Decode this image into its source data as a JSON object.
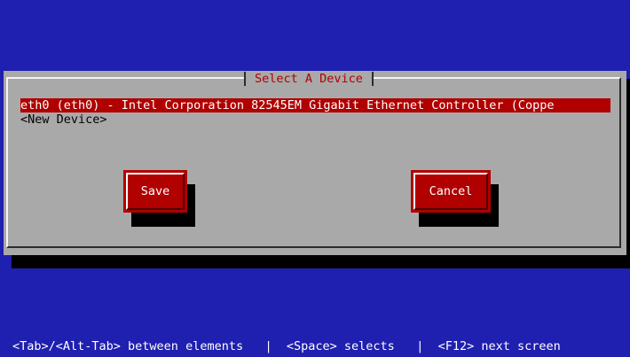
{
  "dialog": {
    "title": "Select A Device",
    "devices": [
      {
        "label": "eth0 (eth0) - Intel Corporation 82545EM Gigabit Ethernet Controller (Coppe",
        "selected": true
      },
      {
        "label": "<New Device>",
        "selected": false
      }
    ],
    "buttons": {
      "save_label": "Save",
      "cancel_label": "Cancel"
    }
  },
  "status_bar": {
    "hint_1": "<Tab>/<Alt-Tab> between elements",
    "separator": "|",
    "hint_2": "<Space> selects",
    "hint_3": "<F12> next screen"
  },
  "colors": {
    "background": "#1f1fb0",
    "dialog": "#a9a9a9",
    "accent": "#b00000",
    "shadow": "#000000"
  }
}
